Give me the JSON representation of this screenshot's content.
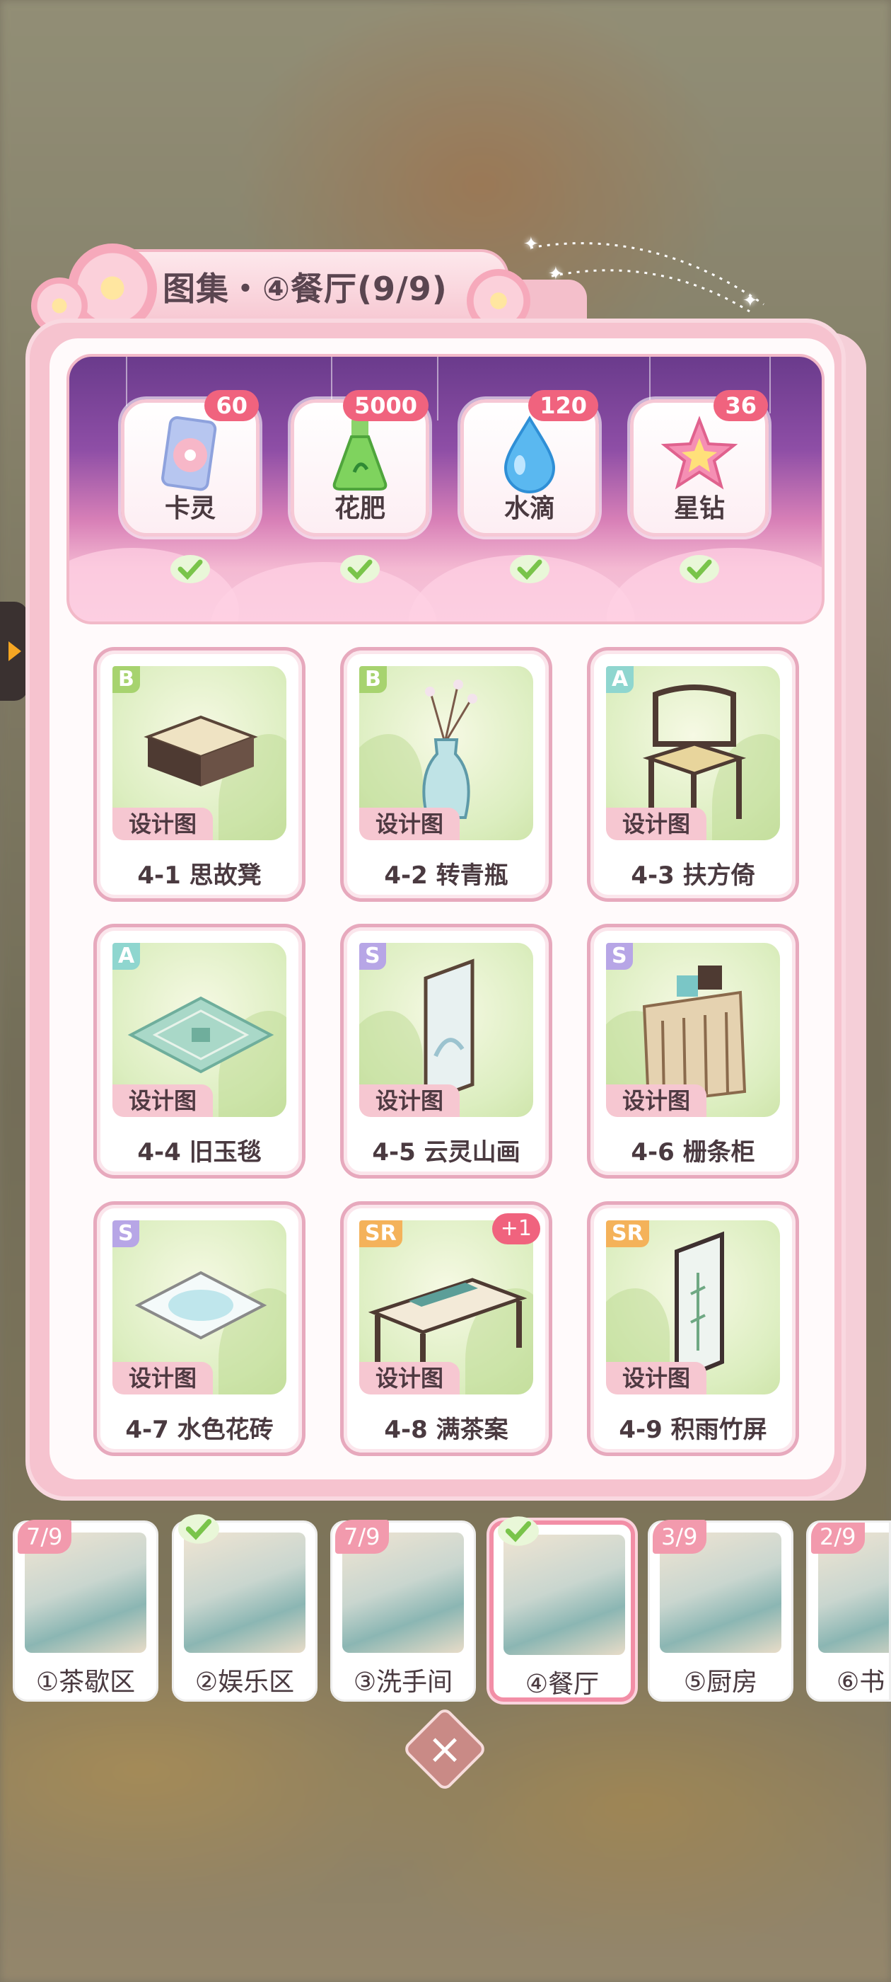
{
  "title": "图集・④餐厅(9/9)",
  "rewards": [
    {
      "label": "卡灵",
      "count": "60",
      "icon": "card-spirit-icon"
    },
    {
      "label": "花肥",
      "count": "5000",
      "icon": "fertilizer-flask-icon"
    },
    {
      "label": "水滴",
      "count": "120",
      "icon": "water-drop-icon"
    },
    {
      "label": "星钻",
      "count": "36",
      "icon": "star-diamond-icon"
    }
  ],
  "design_tag": "设计图",
  "items": [
    {
      "name": "4-1 思故凳",
      "rarity": "B"
    },
    {
      "name": "4-2 转青瓶",
      "rarity": "B"
    },
    {
      "name": "4-3 扶方倚",
      "rarity": "A"
    },
    {
      "name": "4-4 旧玉毯",
      "rarity": "A"
    },
    {
      "name": "4-5 云灵山画",
      "rarity": "S"
    },
    {
      "name": "4-6 栅条柜",
      "rarity": "S"
    },
    {
      "name": "4-7 水色花砖",
      "rarity": "S"
    },
    {
      "name": "4-8 满茶案",
      "rarity": "SR",
      "badge": "+1"
    },
    {
      "name": "4-9 积雨竹屏",
      "rarity": "SR"
    }
  ],
  "rarity_colors": {
    "B": "#a7d36f",
    "A": "#8fd6cf",
    "S": "#b7a6e6",
    "SR": "#f4b25a"
  },
  "tabs": [
    {
      "label": "①茶歇区",
      "progress": "7/9"
    },
    {
      "label": "②娱乐区",
      "complete": true
    },
    {
      "label": "③洗手间",
      "progress": "7/9"
    },
    {
      "label": "④餐厅",
      "complete": true,
      "active": true
    },
    {
      "label": "⑤厨房",
      "progress": "3/9"
    },
    {
      "label": "⑥书",
      "progress": "2/9"
    }
  ]
}
